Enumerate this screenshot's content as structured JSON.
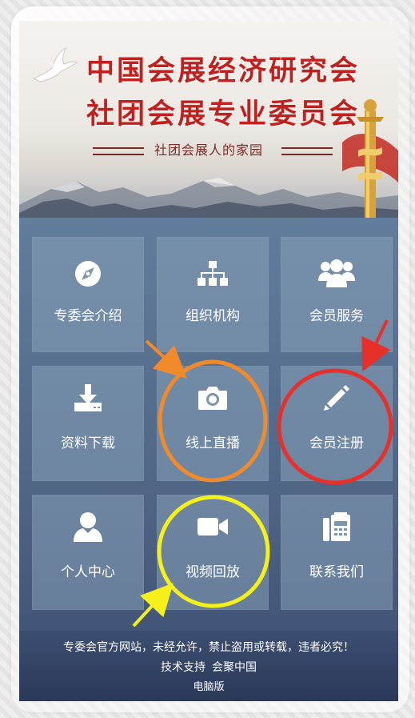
{
  "header": {
    "title_line1": "中国会展经济研究会",
    "title_line2": "社团会展专业委员会",
    "slogan": "社团会展人的家园"
  },
  "menu": [
    {
      "label": "专委会介绍",
      "icon": "compass-icon"
    },
    {
      "label": "组织机构",
      "icon": "org-chart-icon"
    },
    {
      "label": "会员服务",
      "icon": "users-icon"
    },
    {
      "label": "资料下载",
      "icon": "download-icon"
    },
    {
      "label": "线上直播",
      "icon": "camera-icon"
    },
    {
      "label": "会员注册",
      "icon": "pencil-icon"
    },
    {
      "label": "个人中心",
      "icon": "user-icon"
    },
    {
      "label": "视频回放",
      "icon": "video-camera-icon"
    },
    {
      "label": "联系我们",
      "icon": "fax-icon"
    }
  ],
  "footer": {
    "notice": "专委会官方网站，未经允许，禁止盗用或转载，违者必究！",
    "tech_support_label": "技术支持",
    "tech_support_value": "会聚中国",
    "desktop_link": "电脑版"
  },
  "colors": {
    "title_red": "#c0211f",
    "tile_bg": "#87a0b9",
    "annot_orange": "#f08a2a",
    "annot_red": "#e8302a",
    "annot_yellow": "#f5f01a"
  }
}
